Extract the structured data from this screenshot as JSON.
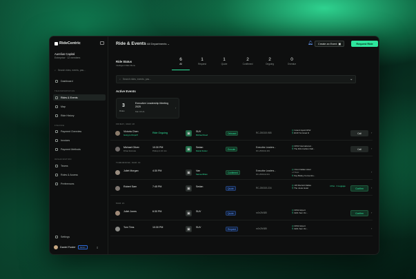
{
  "app": {
    "name": "RideCentric"
  },
  "org": {
    "name": "Aurelius Capital",
    "sub": "Enterprise · 12 members"
  },
  "sidebar": {
    "search_placeholder": "Search rides, events, pas...",
    "dashboard": "Dashboard",
    "sec_transport": "TRANSPORTATION",
    "rides": "Rides & Events",
    "map": "Map",
    "history": "Ride History",
    "sec_finance": "FINANCE",
    "payments": "Payment Overview",
    "invoices": "Invoices",
    "methods": "Payment Methods",
    "sec_org": "ORGANIZATION",
    "teams": "Teams",
    "roles": "Roles & Access",
    "prefs": "Preferences",
    "settings": "Settings",
    "user": "Daniel Foster",
    "badge": "Admin"
  },
  "header": {
    "title": "Ride & Events",
    "dept": "All Departments",
    "create": "Create an Event",
    "request": "Request Ride"
  },
  "ride_status": {
    "title": "Ride Status",
    "sub": "Intelligent Ride Menu",
    "stats": [
      {
        "num": "6",
        "label": "All"
      },
      {
        "num": "1",
        "label": "Request"
      },
      {
        "num": "1",
        "label": "Quote"
      },
      {
        "num": "2",
        "label": "Confirmed"
      },
      {
        "num": "2",
        "label": "Ongoing"
      },
      {
        "num": "0",
        "label": "Overdue"
      }
    ]
  },
  "search_placeholder": "Search rides, events, pas...",
  "active_events": {
    "title": "Active Events",
    "card": {
      "count": "3",
      "count_label": "Rides",
      "name": "Executive Leadership Meeting 2025",
      "date": "Mar 18-21"
    }
  },
  "days": [
    "FRIDAY, MAR 18",
    "TOMORROW, MAR 19",
    "MAR 21"
  ],
  "rows": [
    {
      "name": "Victoria Chen",
      "status_text": "Going to Dropoff",
      "time": "Ride Ongoing",
      "time_sub": "",
      "vehicle": "SUV",
      "driver": "Michael Reed",
      "badge": "Onboard",
      "event": "RC-250319-985",
      "event_sub": "",
      "from": "Grand Hyatt DFW",
      "to": "DFW Terminal D",
      "pax": "",
      "action": "Call"
    },
    {
      "name": "Michael Oliver",
      "status_text": "Driver Enroute",
      "time": "10:30 PM",
      "time_sub": "Pickup in 10 min",
      "vehicle": "Sedan",
      "driver": "Daniel Foster",
      "badge": "Enroute",
      "event": "Executive Leaders...",
      "event_sub": "RC-250319-163",
      "from": "DFW International...",
      "to": "The Ritz-Carlton Dall...",
      "pax": "",
      "action": "Call"
    },
    {
      "name": "Juliet Morgan",
      "status_text": "",
      "time": "4:30 PM",
      "time_sub": "",
      "vehicle": "Van",
      "driver": "Samuel Brian",
      "badge": "Confirmed",
      "event": "Executive Leaders...",
      "event_sub": "RC-250319-001",
      "from": "Omni Dallas Hotel",
      "to": "Kay Bailey Conventio...",
      "stop": "+2 Stops",
      "pax": "",
      "action": ""
    },
    {
      "name": "Robert Sam",
      "status_text": "",
      "time": "7:45 PM",
      "time_sub": "",
      "vehicle": "Sedan",
      "driver": "",
      "badge": "Quote",
      "event": "RC-250319-234",
      "event_sub": "",
      "from": "JW Marriott Dallas",
      "to": "The Joule Hotel",
      "pax": "4 Pax · 3 Luggage",
      "action": "Confirm"
    },
    {
      "name": "Juliet Jones",
      "status_text": "",
      "time": "6:30 PM",
      "time_sub": "",
      "vehicle": "SUV",
      "driver": "",
      "badge": "Quote",
      "event": "rc0v25r385",
      "event_sub": "",
      "from": "DFW Airport",
      "to": "3221 San Vic...",
      "pax": "",
      "action": "Confirm"
    },
    {
      "name": "Tom Tims",
      "status_text": "",
      "time": "10:30 PM",
      "time_sub": "",
      "vehicle": "SUV",
      "driver": "",
      "badge": "Request",
      "event": "rc0v25r385",
      "event_sub": "",
      "from": "DFW Airport",
      "to": "3221 San Vic...",
      "pax": "",
      "action": ""
    }
  ]
}
